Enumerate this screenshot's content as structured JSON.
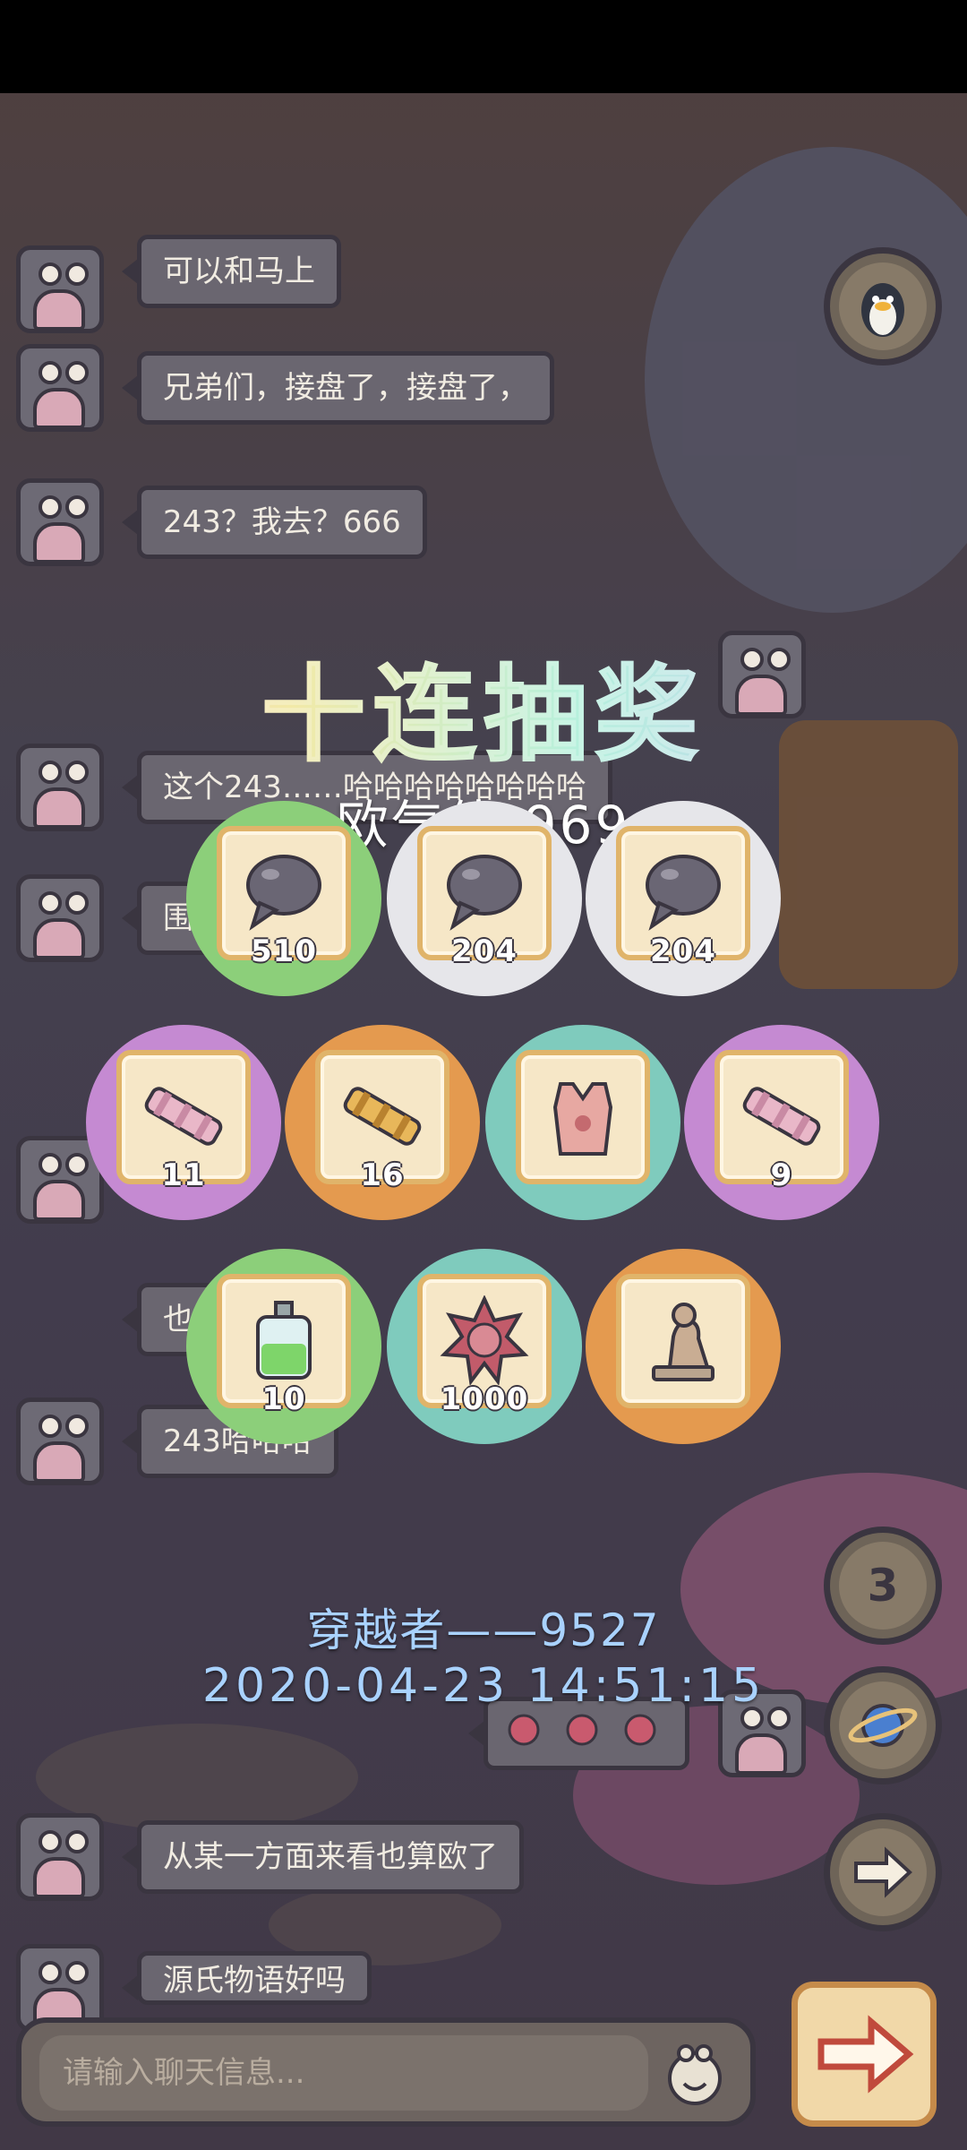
{
  "chat": {
    "messages": [
      {
        "text": "可以和马上"
      },
      {
        "text": "兄弟们，接盘了，接盘了，"
      },
      {
        "text": "243？我去？666"
      },
      {
        "text": "这个243……哈哈哈哈哈哈哈哈"
      },
      {
        "text": "围"
      },
      {
        "text": "也太非"
      },
      {
        "text": "243哈哈哈"
      },
      {
        "text": "从某一方面来看也算欧了"
      },
      {
        "text": "源氏物语好吗"
      }
    ],
    "input_placeholder": "请输入聊天信息..."
  },
  "gacha": {
    "title": "十连抽奖",
    "luck_label": "欧气值",
    "luck_value": "969",
    "items": [
      {
        "name": "grey-bubble",
        "count": "510",
        "color": "#8ccf7a"
      },
      {
        "name": "grey-bubble",
        "count": "204",
        "color": "#e6e6ea"
      },
      {
        "name": "grey-bubble",
        "count": "204",
        "color": "#e6e6ea"
      },
      {
        "name": "pink-scroll",
        "count": "11",
        "color": "#c58ad2"
      },
      {
        "name": "golden-scroll",
        "count": "16",
        "color": "#e49a4f"
      },
      {
        "name": "pink-vest",
        "count": "",
        "color": "#7fcbbd"
      },
      {
        "name": "pink-scroll",
        "count": "9",
        "color": "#c58ad2"
      },
      {
        "name": "green-potion",
        "count": "10",
        "color": "#8ccf7a"
      },
      {
        "name": "sea-urchin",
        "count": "1000",
        "color": "#7fcbbd"
      },
      {
        "name": "thinker-statue",
        "count": "",
        "color": "#e49a4f"
      }
    ],
    "player": "穿越者——9527",
    "timestamp": "2020-04-23  14:51:15"
  },
  "side": {
    "badge_number": "3"
  }
}
